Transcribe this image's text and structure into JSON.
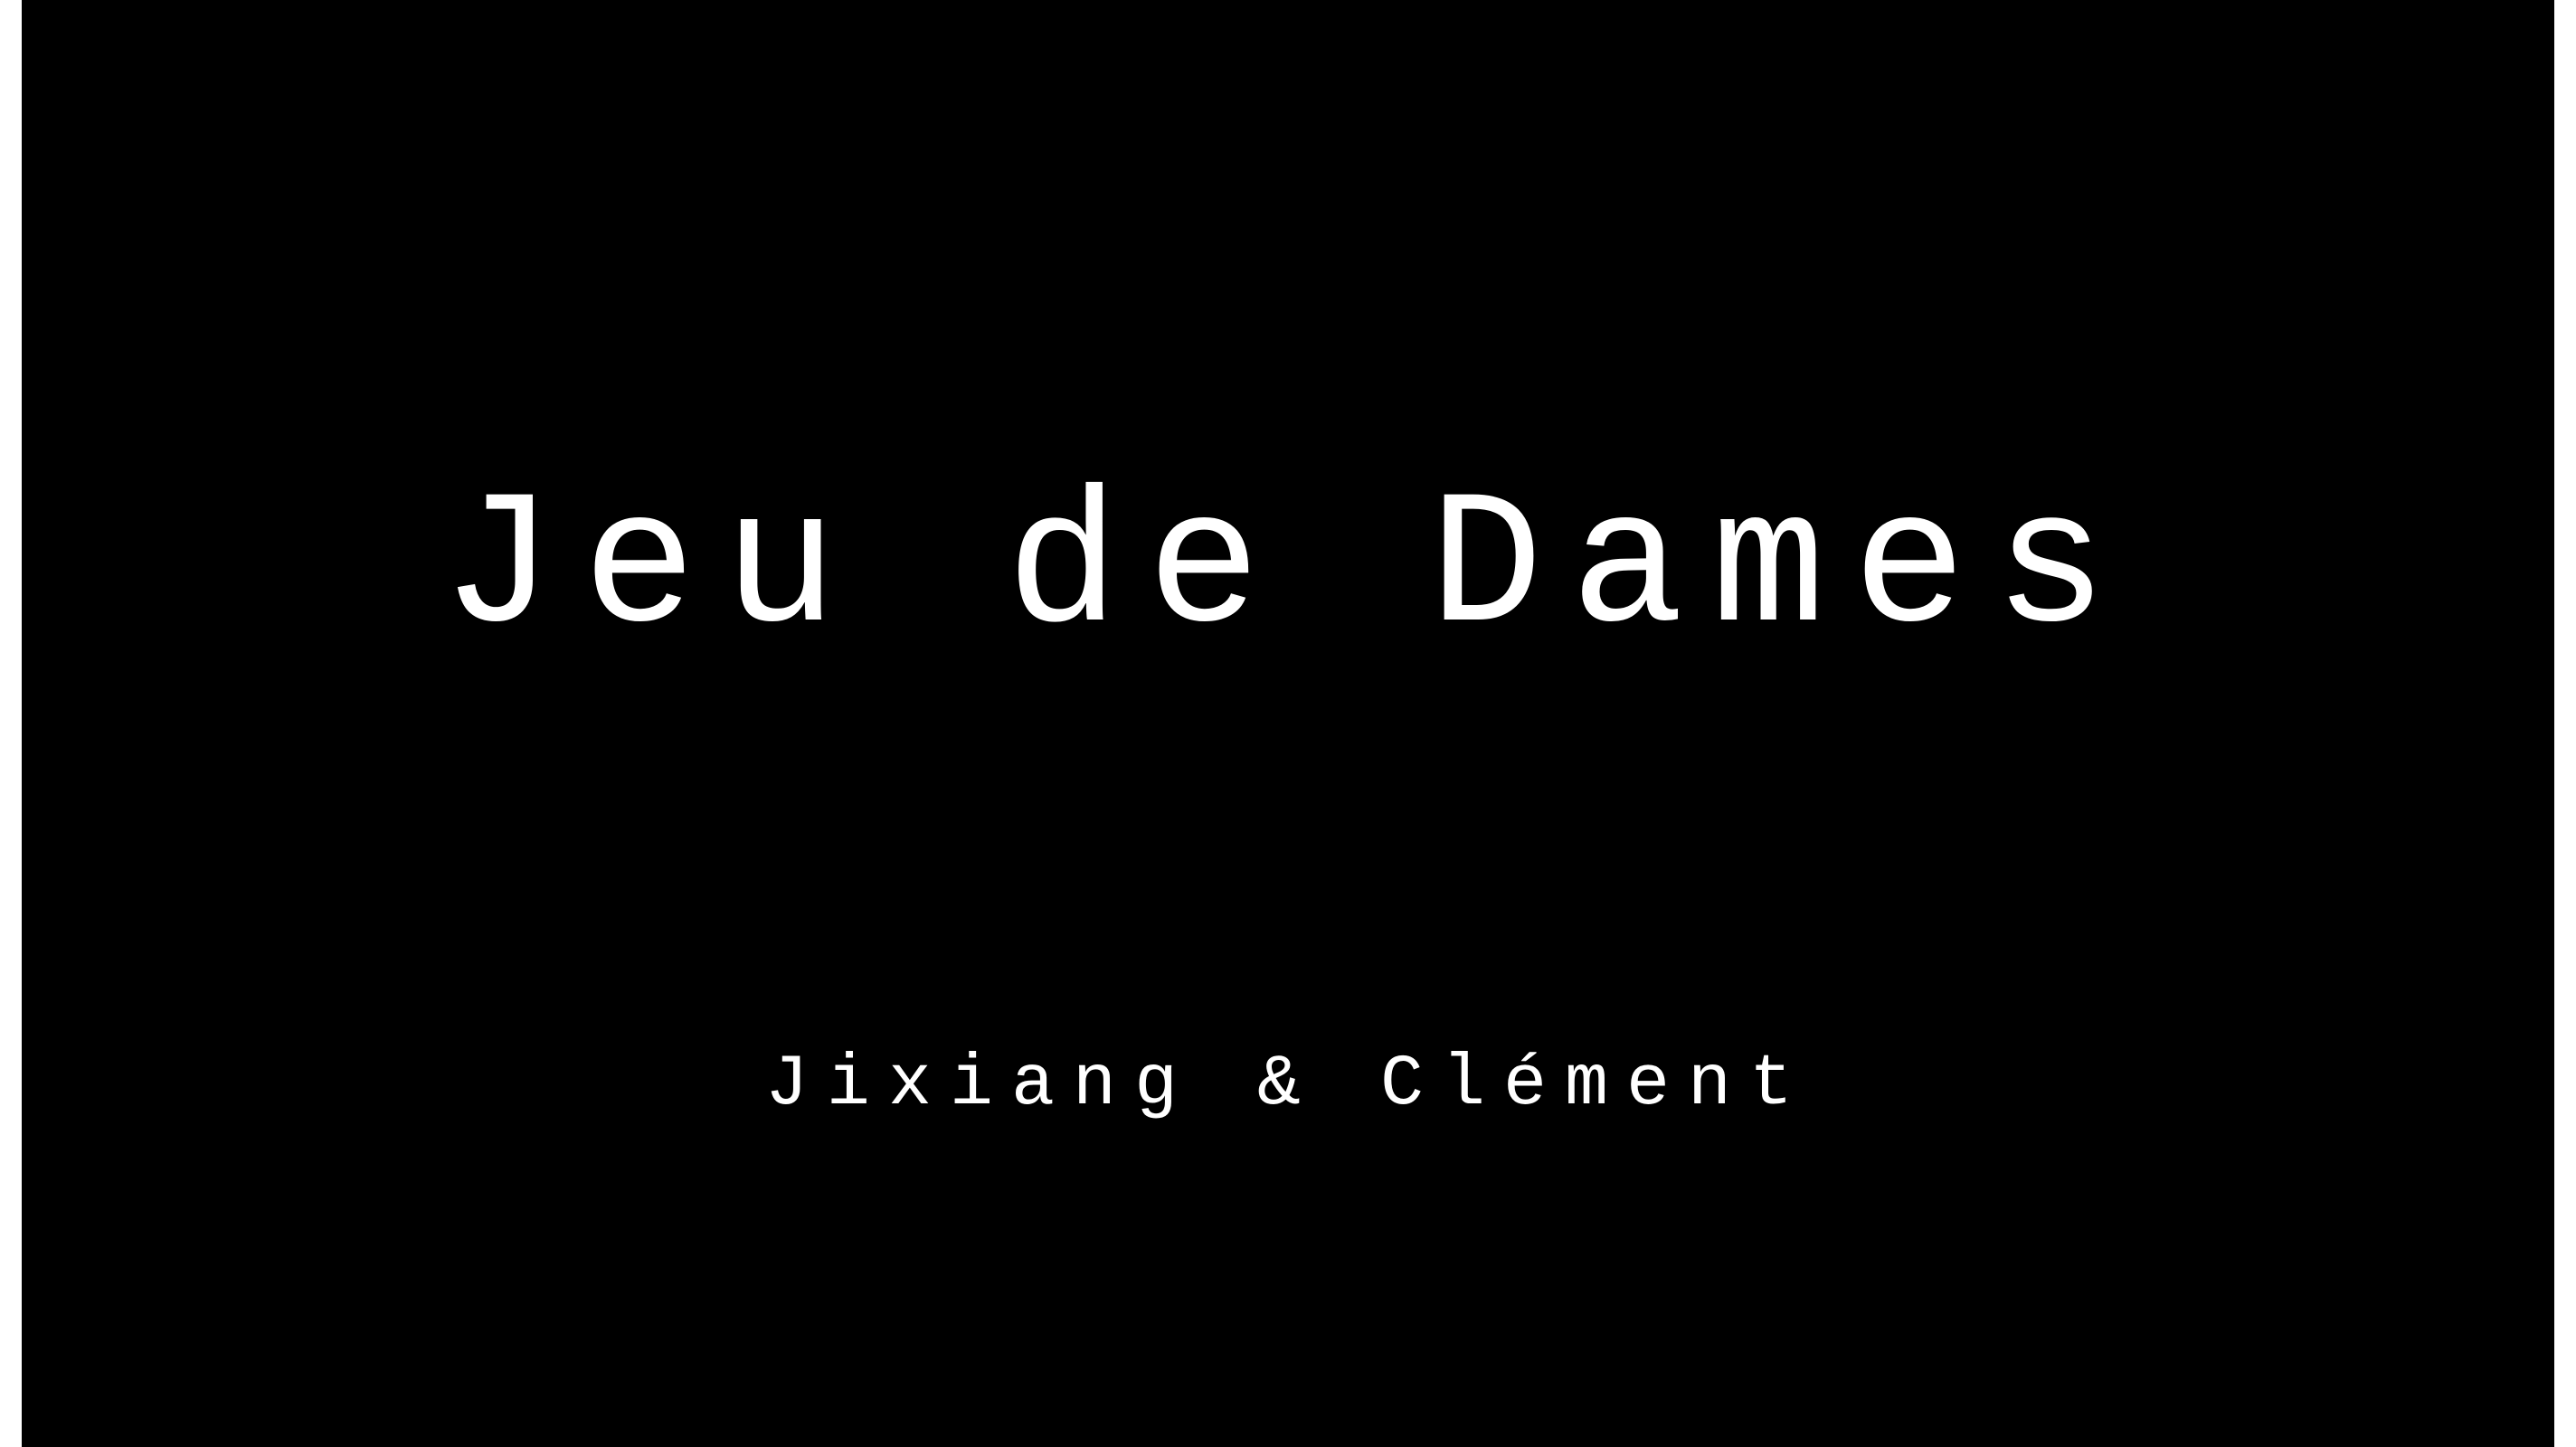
{
  "slide": {
    "title": "Jeu de Dames",
    "subtitle": "Jixiang & Clément"
  },
  "colors": {
    "background": "#000000",
    "text": "#ffffff",
    "frame": "#ffffff"
  }
}
